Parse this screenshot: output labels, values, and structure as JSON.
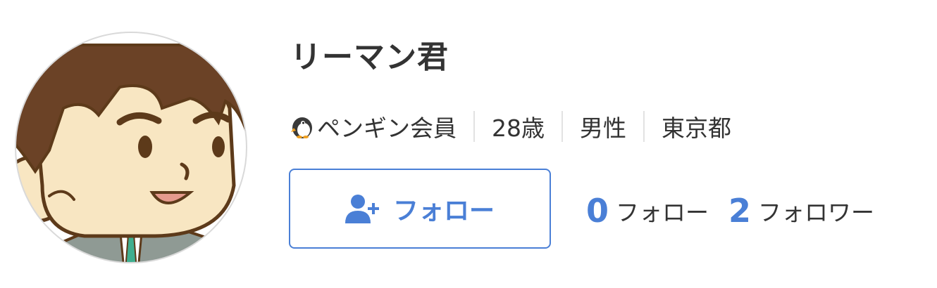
{
  "profile": {
    "name": "リーマン君",
    "membership": "ペンギン会員",
    "age": "28歳",
    "gender": "男性",
    "location": "東京都"
  },
  "follow_button": {
    "label": "フォロー",
    "icon": "user-plus-icon"
  },
  "stats": {
    "following_count": "0",
    "following_label": "フォロー",
    "followers_count": "2",
    "followers_label": "フォロワー"
  },
  "colors": {
    "accent": "#4a7fd6",
    "text": "#333333",
    "divider": "#e2e2e2"
  }
}
